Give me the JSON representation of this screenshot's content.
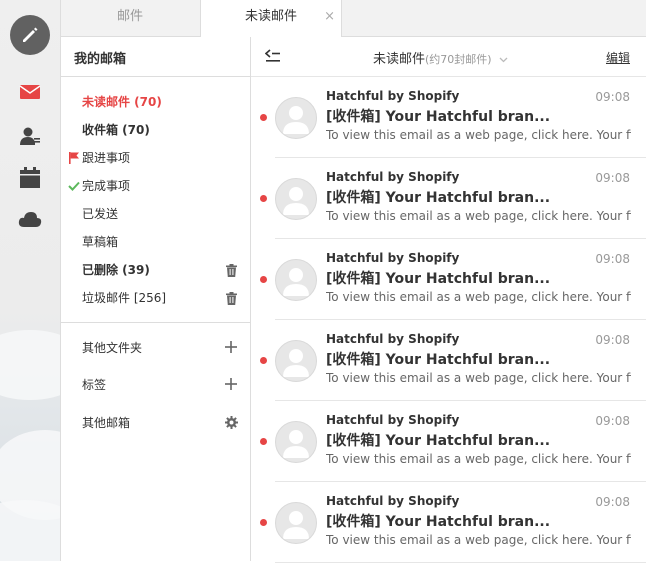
{
  "tabs": [
    {
      "label": "邮件"
    },
    {
      "label": "未读邮件",
      "close": "×"
    }
  ],
  "rail": {
    "icons": [
      "compose-pen-icon",
      "mail-icon",
      "contacts-icon",
      "calendar-icon",
      "cloud-icon"
    ]
  },
  "folders": {
    "title": "我的邮箱",
    "items": [
      {
        "label": "未读邮件 (70)",
        "style": "red-bold"
      },
      {
        "label": "收件箱 (70)",
        "style": "bold"
      },
      {
        "label": "跟进事项",
        "icon": "flag-icon"
      },
      {
        "label": "完成事项",
        "icon": "check-icon"
      },
      {
        "label": "已发送"
      },
      {
        "label": "草稿箱"
      },
      {
        "label": "已删除 (39)",
        "style": "bold",
        "right_icon": "trash-icon"
      },
      {
        "label": "垃圾邮件 [256]",
        "right_icon": "trash-icon"
      }
    ],
    "extras": [
      {
        "label": "其他文件夹",
        "right_icon": "plus-icon"
      },
      {
        "label": "标签",
        "right_icon": "plus-icon"
      },
      {
        "label": "其他邮箱",
        "right_icon": "gear-icon"
      }
    ]
  },
  "list": {
    "title": "未读邮件",
    "count": "(约70封邮件)",
    "edit_label": "编辑",
    "emails": [
      {
        "sender": "Hatchful by Shopify",
        "time": "09:08",
        "subject": "[收件箱] Your Hatchful bran...",
        "preview": "To view this email as a web page, click here. Your files ..."
      },
      {
        "sender": "Hatchful by Shopify",
        "time": "09:08",
        "subject": "[收件箱] Your Hatchful bran...",
        "preview": "To view this email as a web page, click here. Your files ..."
      },
      {
        "sender": "Hatchful by Shopify",
        "time": "09:08",
        "subject": "[收件箱] Your Hatchful bran...",
        "preview": "To view this email as a web page, click here. Your files ..."
      },
      {
        "sender": "Hatchful by Shopify",
        "time": "09:08",
        "subject": "[收件箱] Your Hatchful bran...",
        "preview": "To view this email as a web page, click here. Your files ..."
      },
      {
        "sender": "Hatchful by Shopify",
        "time": "09:08",
        "subject": "[收件箱] Your Hatchful bran...",
        "preview": "To view this email as a web page, click here. Your files ..."
      },
      {
        "sender": "Hatchful by Shopify",
        "time": "09:08",
        "subject": "[收件箱] Your Hatchful bran...",
        "preview": "To view this email as a web page, click here. Your files ..."
      }
    ]
  },
  "colors": {
    "accent_red": "#e64545",
    "compose_bg": "#616161",
    "check_green": "#5cb85c"
  }
}
